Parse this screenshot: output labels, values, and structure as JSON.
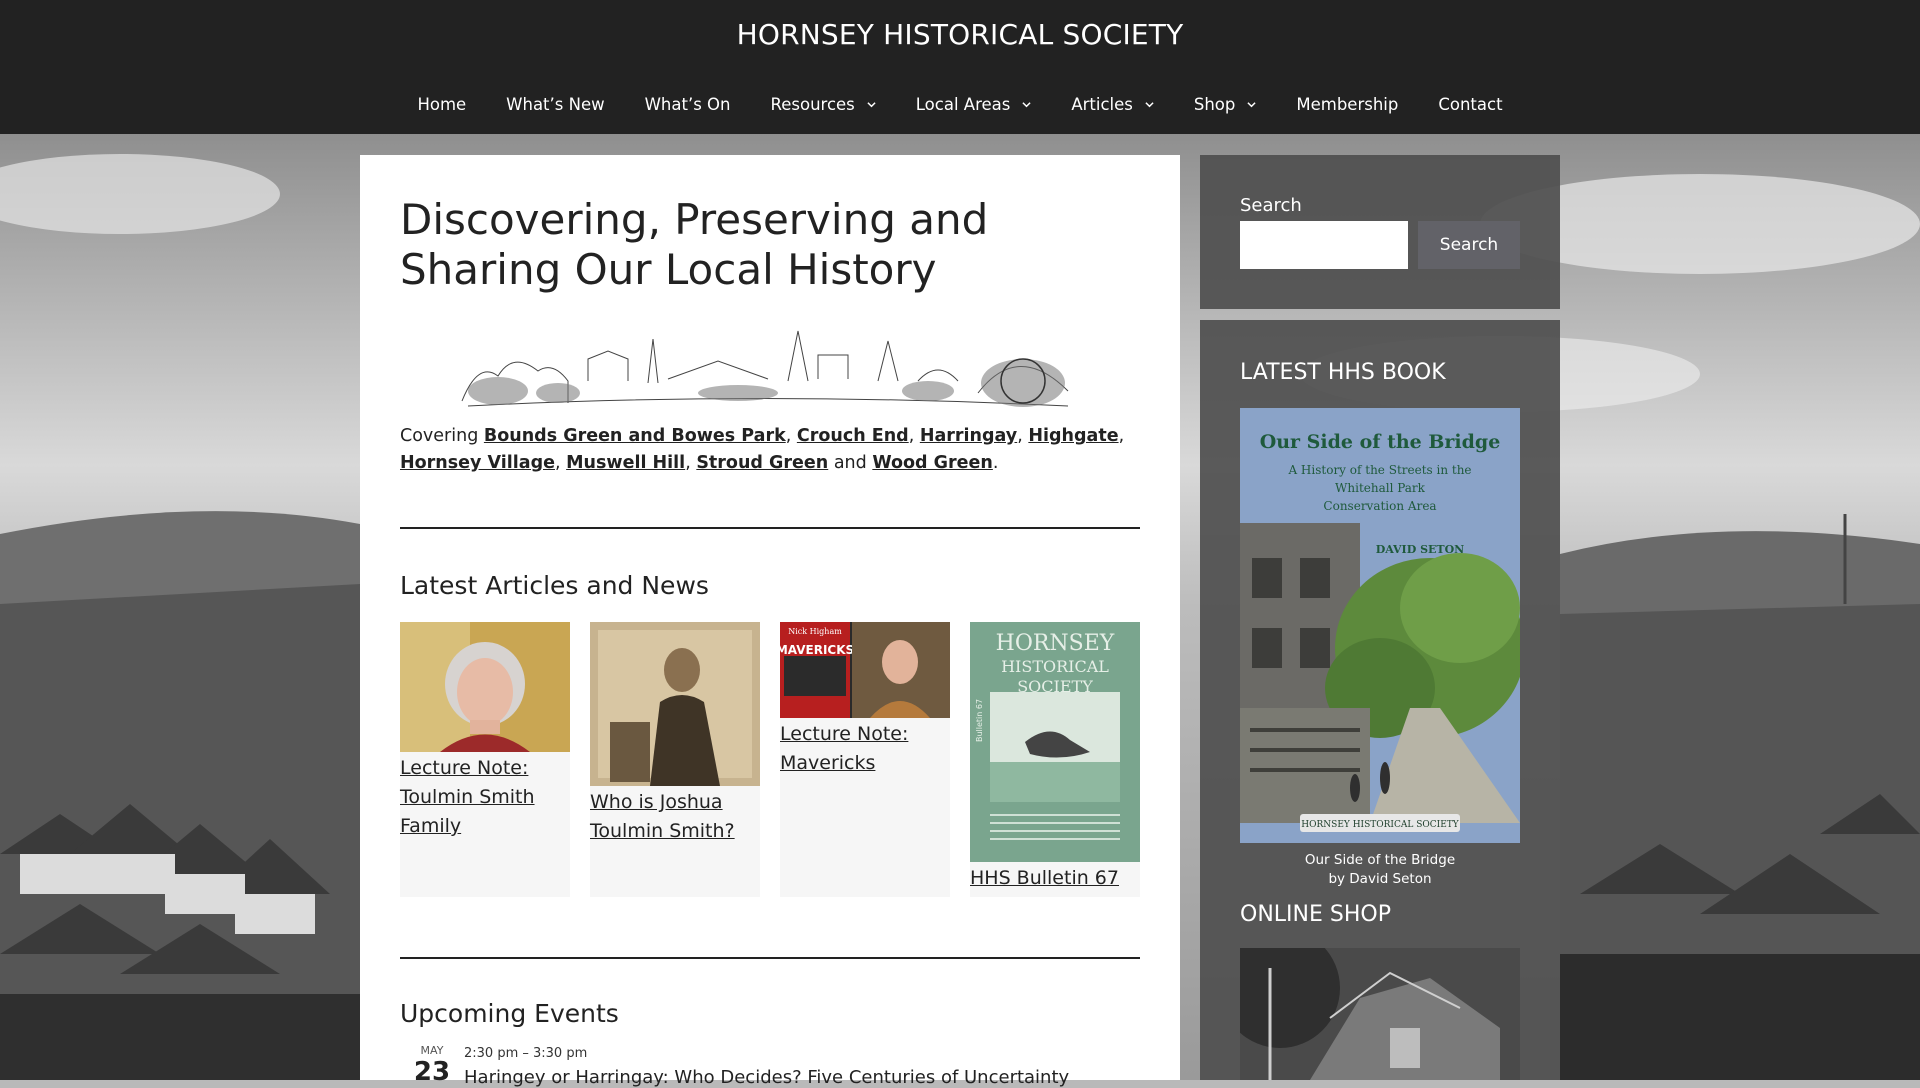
{
  "site": {
    "title": "HORNSEY HISTORICAL SOCIETY"
  },
  "nav": {
    "items": [
      {
        "label": "Home",
        "has_submenu": false
      },
      {
        "label": "What’s New",
        "has_submenu": false
      },
      {
        "label": "What’s On",
        "has_submenu": false
      },
      {
        "label": "Resources",
        "has_submenu": true
      },
      {
        "label": "Local Areas",
        "has_submenu": true
      },
      {
        "label": "Articles",
        "has_submenu": true
      },
      {
        "label": "Shop",
        "has_submenu": true
      },
      {
        "label": "Membership",
        "has_submenu": false
      },
      {
        "label": "Contact",
        "has_submenu": false
      }
    ]
  },
  "main": {
    "title": "Discovering, Preserving and Sharing Our Local History",
    "covering": {
      "prefix": "Covering",
      "areas": [
        "Bounds Green and Bowes Park",
        "Crouch End",
        "Harringay",
        "Highgate",
        "Hornsey Village",
        "Muswell Hill",
        "Stroud Green",
        "Wood Green"
      ],
      "and_word": "and"
    },
    "articles_heading": "Latest Articles and News",
    "articles": [
      {
        "title": "Lecture Note: Toulmin Smith Family"
      },
      {
        "title": "Who is Joshua Toulmin Smith?"
      },
      {
        "title": "Lecture Note: Mavericks"
      },
      {
        "title": "HHS Bulletin 67"
      }
    ],
    "article_thumb_text": {
      "mavericks": "MAVERICKS",
      "author": "Nick Higham",
      "bulletin_line1": "HORNSEY",
      "bulletin_line2": "HISTORICAL",
      "bulletin_line3": "SOCIETY",
      "bulletin_side": "Bulletin 67"
    },
    "events_heading": "Upcoming Events",
    "events": [
      {
        "month": "May",
        "day": "23",
        "time": "2:30 pm – 3:30 pm",
        "title": "Haringey or Harringay: Who Decides? Five Centuries of Uncertainty"
      }
    ]
  },
  "sidebar": {
    "search": {
      "label": "Search",
      "placeholder": "",
      "value": "",
      "button_label": "Search"
    },
    "book": {
      "heading": "LATEST HHS BOOK",
      "cover_title": "Our Side of the Bridge",
      "cover_subtitle_1": "A History of the Streets in the",
      "cover_subtitle_2": "Whitehall Park",
      "cover_subtitle_3": "Conservation Area",
      "cover_author": "DAVID SETON",
      "cover_publisher": "HORNSEY HISTORICAL SOCIETY",
      "caption_line1": "Our Side of the Bridge",
      "caption_line2": "by David Seton"
    },
    "shop": {
      "heading": "ONLINE SHOP"
    }
  },
  "colors": {
    "header_bg": "#222222",
    "text": "#222222",
    "widget_bg": "#505050",
    "search_button": "#626268",
    "book_cover_bg": "#8aa3c8",
    "book_title": "#1f5a3c",
    "bulletin_bg": "#7aa58e"
  },
  "icons": {
    "submenu": "chevron-down-icon"
  }
}
